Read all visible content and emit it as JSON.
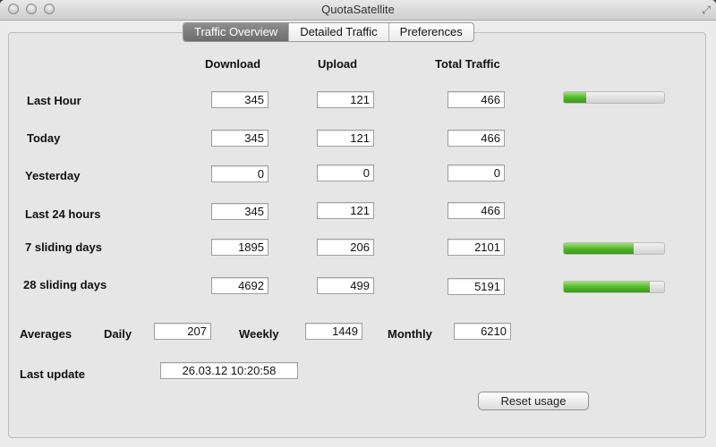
{
  "window": {
    "title": "QuotaSatellite"
  },
  "tabs": [
    {
      "label": "Traffic Overview",
      "active": true
    },
    {
      "label": "Detailed Traffic",
      "active": false
    },
    {
      "label": "Preferences",
      "active": false
    }
  ],
  "columns": {
    "download": "Download",
    "upload": "Upload",
    "total": "Total Traffic"
  },
  "rows": [
    {
      "label": "Last Hour",
      "download": "345",
      "upload": "121",
      "total": "466",
      "usage": 0.22
    },
    {
      "label": "Today",
      "download": "345",
      "upload": "121",
      "total": "466"
    },
    {
      "label": "Yesterday",
      "download": "0",
      "upload": "0",
      "total": "0"
    },
    {
      "label": "Last 24 hours",
      "download": "345",
      "upload": "121",
      "total": "466"
    },
    {
      "label": "7 sliding days",
      "download": "1895",
      "upload": "206",
      "total": "2101",
      "usage": 0.7
    },
    {
      "label": "28 sliding days",
      "download": "4692",
      "upload": "499",
      "total": "5191",
      "usage": 0.86
    }
  ],
  "averages": {
    "label": "Averages",
    "daily_label": "Daily",
    "daily": "207",
    "weekly_label": "Weekly",
    "weekly": "1449",
    "monthly_label": "Monthly",
    "monthly": "6210"
  },
  "last_update": {
    "label": "Last update",
    "value": "26.03.12 10:20:58"
  },
  "reset_button": "Reset usage",
  "colors": {
    "bar_green": "#4fb526",
    "tab_active": "#7a7a7a"
  }
}
